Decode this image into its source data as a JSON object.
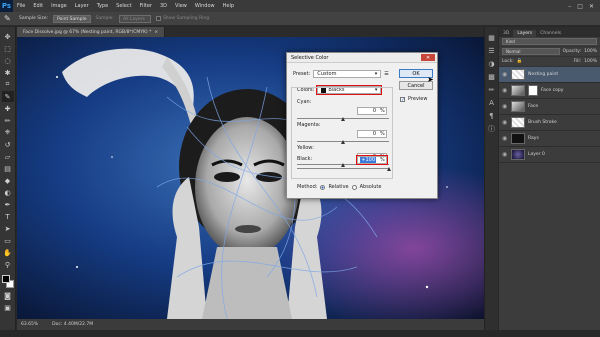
{
  "menubar": {
    "logo": "Ps",
    "items": [
      "File",
      "Edit",
      "Image",
      "Layer",
      "Type",
      "Select",
      "Filter",
      "3D",
      "View",
      "Window",
      "Help"
    ],
    "controls": [
      "–",
      "□",
      "✕"
    ]
  },
  "options": {
    "sample_size_label": "Sample Size:",
    "sample_size_value": "Point Sample",
    "sample_label": "Sample:",
    "sample_value": "All Layers",
    "show_ring_label": "Show Sampling Ring"
  },
  "document": {
    "tab_title": "Face Dissolve.jpg @ 67% (Nesting paint, RGB/8*/CMYK) *",
    "tab_close": "×",
    "zoom": "63.65%",
    "doc_info": "Doc: 4.40M/22.7M"
  },
  "layers_panel": {
    "tabs": [
      "3D",
      "Layers",
      "Channels"
    ],
    "kind_label": "Kind",
    "blend_mode": "Normal",
    "opacity_label": "Opacity:",
    "opacity_value": "100%",
    "lock_label": "Lock:",
    "fill_label": "Fill:",
    "fill_value": "100%",
    "layers": [
      {
        "name": "Nesting paint",
        "thumb": "checker",
        "selected": true
      },
      {
        "name": "Face copy",
        "thumb": "photo",
        "mask": true,
        "selected": false
      },
      {
        "name": "Face",
        "thumb": "photo",
        "selected": false
      },
      {
        "name": "Brush Stroke",
        "thumb": "checker",
        "selected": false
      },
      {
        "name": "Rays",
        "thumb": "black",
        "selected": false
      },
      {
        "name": "Layer 0",
        "thumb": "dark",
        "selected": false
      }
    ]
  },
  "dialog": {
    "title": "Selective Color",
    "close": "✕",
    "preset_label": "Preset:",
    "preset_value": "Custom",
    "colors_label": "Colors:",
    "colors_value": "Blacks",
    "cyan_label": "Cyan:",
    "cyan_value": "0",
    "magenta_label": "Magenta:",
    "magenta_value": "0",
    "yellow_label": "Yellow:",
    "yellow_value": "0",
    "black_label": "Black:",
    "black_value": "+100",
    "percent": "%",
    "ok_label": "OK",
    "cancel_label": "Cancel",
    "preview_label": "Preview",
    "method_label": "Method:",
    "relative_label": "Relative",
    "absolute_label": "Absolute"
  }
}
